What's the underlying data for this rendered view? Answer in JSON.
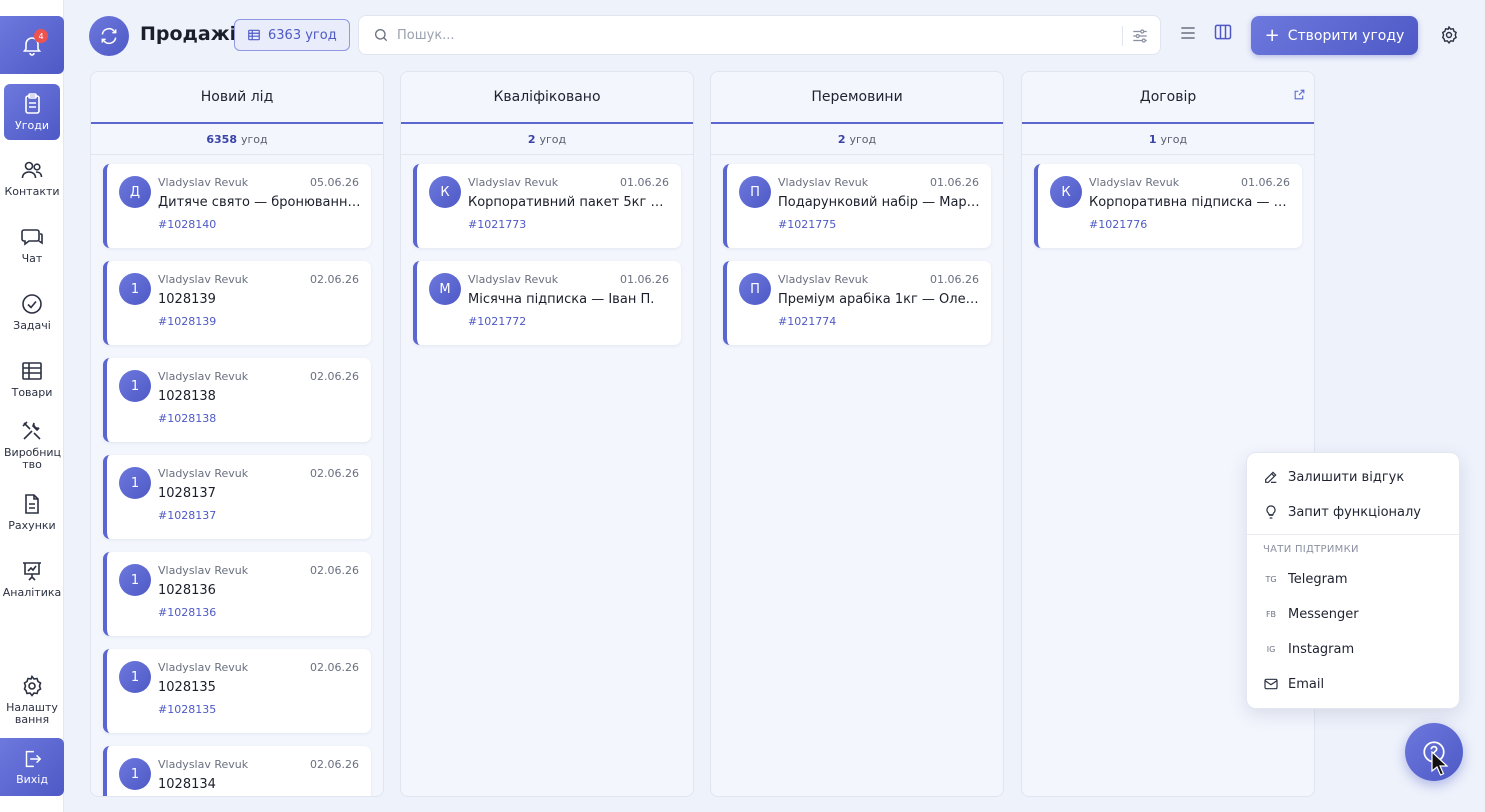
{
  "sidebar": {
    "notification_count": "4",
    "items": [
      {
        "label": "Угоди"
      },
      {
        "label": "Контакти"
      },
      {
        "label": "Чат"
      },
      {
        "label": "Задачі"
      },
      {
        "label": "Товари"
      },
      {
        "label": "Виробниц тво"
      },
      {
        "label": "Рахунки"
      },
      {
        "label": "Аналітика"
      },
      {
        "label": "Налашту вання"
      },
      {
        "label": "Вихід"
      }
    ]
  },
  "header": {
    "title": "Продажі",
    "deals_count": "6363 угод",
    "search_placeholder": "Пошук...",
    "create_label": "Створити угоду"
  },
  "columns": [
    {
      "title": "Новий лід",
      "count": "6358",
      "count_suffix": "угод",
      "cards": [
        {
          "avatar": "Д",
          "author": "Vladyslav Revuk",
          "date": "05.06.26",
          "title": "Дитяче свято — бронювання…",
          "id": "#1028140"
        },
        {
          "avatar": "1",
          "author": "Vladyslav Revuk",
          "date": "02.06.26",
          "title": "1028139",
          "id": "#1028139"
        },
        {
          "avatar": "1",
          "author": "Vladyslav Revuk",
          "date": "02.06.26",
          "title": "1028138",
          "id": "#1028138"
        },
        {
          "avatar": "1",
          "author": "Vladyslav Revuk",
          "date": "02.06.26",
          "title": "1028137",
          "id": "#1028137"
        },
        {
          "avatar": "1",
          "author": "Vladyslav Revuk",
          "date": "02.06.26",
          "title": "1028136",
          "id": "#1028136"
        },
        {
          "avatar": "1",
          "author": "Vladyslav Revuk",
          "date": "02.06.26",
          "title": "1028135",
          "id": "#1028135"
        },
        {
          "avatar": "1",
          "author": "Vladyslav Revuk",
          "date": "02.06.26",
          "title": "1028134",
          "id": ""
        }
      ]
    },
    {
      "title": "Кваліфіковано",
      "count": "2",
      "count_suffix": "угод",
      "cards": [
        {
          "avatar": "К",
          "author": "Vladyslav Revuk",
          "date": "01.06.26",
          "title": "Корпоративний пакет 5кг — …",
          "id": "#1021773"
        },
        {
          "avatar": "М",
          "author": "Vladyslav Revuk",
          "date": "01.06.26",
          "title": "Місячна підписка — Іван П.",
          "id": "#1021772"
        }
      ]
    },
    {
      "title": "Перемовини",
      "count": "2",
      "count_suffix": "угод",
      "cards": [
        {
          "avatar": "П",
          "author": "Vladyslav Revuk",
          "date": "01.06.26",
          "title": "Подарунковий набір — Марі…",
          "id": "#1021775"
        },
        {
          "avatar": "П",
          "author": "Vladyslav Revuk",
          "date": "01.06.26",
          "title": "Преміум арабіка 1кг — Олен…",
          "id": "#1021774"
        }
      ]
    },
    {
      "title": "Договір",
      "count": "1",
      "count_suffix": "угод",
      "cards": [
        {
          "avatar": "К",
          "author": "Vladyslav Revuk",
          "date": "01.06.26",
          "title": "Корпоративна підписка — Т…",
          "id": "#1021776"
        }
      ]
    }
  ],
  "help_menu": {
    "feedback": "Залишити відгук",
    "feature_request": "Запит функціоналу",
    "section_label": "ЧАТИ ПІДТРИМКИ",
    "channels": [
      {
        "tag": "TG",
        "label": "Telegram"
      },
      {
        "tag": "FB",
        "label": "Messenger"
      },
      {
        "tag": "IG",
        "label": "Instagram"
      },
      {
        "tag": "",
        "label": "Email"
      }
    ]
  },
  "colors": {
    "accent": "#5b66d0",
    "accent_dark": "#4e59c6",
    "badge_red": "#ef5350",
    "background": "#eef2fb"
  }
}
